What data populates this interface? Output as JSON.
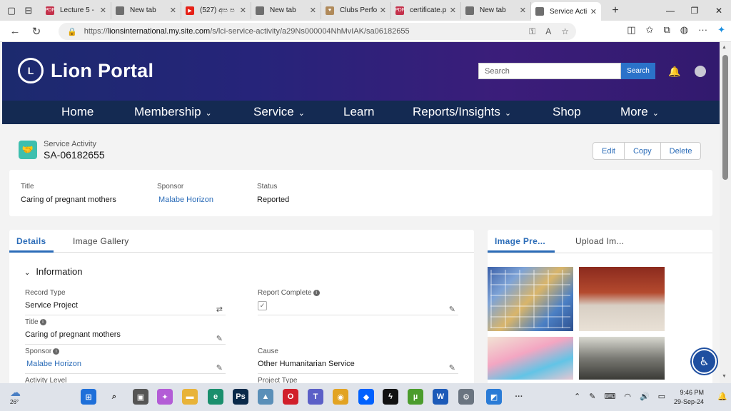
{
  "browser": {
    "tabs": [
      {
        "label": "Lecture 5 -",
        "fav_color": "#c4314b",
        "fav": "PDF"
      },
      {
        "label": "New tab",
        "fav_color": "#6f6f6f",
        "fav": ""
      },
      {
        "label": "(527) අප ප",
        "fav_color": "#e62117",
        "fav": "▶"
      },
      {
        "label": "New tab",
        "fav_color": "#6f6f6f",
        "fav": ""
      },
      {
        "label": "Clubs Perfo",
        "fav_color": "#b08a5a",
        "fav": "♥"
      },
      {
        "label": "certificate.p",
        "fav_color": "#c4314b",
        "fav": "PDF"
      },
      {
        "label": "New tab",
        "fav_color": "#6f6f6f",
        "fav": ""
      },
      {
        "label": "Service Acti",
        "fav_color": "#6f6f6f",
        "fav": ""
      }
    ],
    "url_host": "lionsinternational.my.site.com",
    "url_path": "/s/lci-service-activity/a29Ns000004NhMvIAK/sa06182655",
    "url_scheme": "https://"
  },
  "portal": {
    "title": "Lion Portal",
    "seal_text": "L",
    "search_placeholder": "Search",
    "search_button": "Search",
    "menu": [
      {
        "label": "Home",
        "chev": ""
      },
      {
        "label": "Membership",
        "chev": "⌄"
      },
      {
        "label": "Service",
        "chev": "⌄"
      },
      {
        "label": "Learn",
        "chev": ""
      },
      {
        "label": "Reports/Insights",
        "chev": "⌄"
      },
      {
        "label": "Shop",
        "chev": ""
      },
      {
        "label": "More",
        "chev": "⌄"
      }
    ]
  },
  "record": {
    "type_label": "Service Activity",
    "name": "SA-06182655",
    "actions": [
      "Edit",
      "Copy",
      "Delete"
    ],
    "highlights": [
      {
        "label": "Title",
        "value": "Caring of pregnant mothers"
      },
      {
        "label": "Sponsor",
        "value": "Malabe Horizon"
      },
      {
        "label": "Status",
        "value": "Reported"
      }
    ]
  },
  "details": {
    "tabs": [
      "Details",
      "Image Gallery"
    ],
    "section": "Information",
    "fields": [
      {
        "label": "Record Type",
        "value": "Service Project"
      },
      {
        "label": "Report Complete",
        "value": "✓"
      },
      {
        "label": "Title",
        "value": "Caring of pregnant mothers"
      },
      {
        "label": "Sponsor",
        "value": "Malabe Horizon"
      },
      {
        "label": "Cause",
        "value": "Other Humanitarian Service"
      },
      {
        "label": "Activity Level",
        "value": ""
      },
      {
        "label": "Project Type",
        "value": ""
      }
    ]
  },
  "images": {
    "tabs": [
      "Image Pre...",
      "Upload Im..."
    ]
  },
  "taskbar": {
    "temp": "26°",
    "time": "9:46 PM",
    "date": "29-Sep-24",
    "apps": [
      {
        "label": "⊞",
        "color": "#1e6fd9"
      },
      {
        "label": "⌕",
        "color": "#333"
      },
      {
        "label": "▣",
        "color": "#555"
      },
      {
        "label": "✦",
        "color": "#b35cd6"
      },
      {
        "label": "▬",
        "color": "#e8b339"
      },
      {
        "label": "e",
        "color": "#1a8f6d"
      },
      {
        "label": "Ps",
        "color": "#0b2a4a"
      },
      {
        "label": "▲",
        "color": "#5a8fb8"
      },
      {
        "label": "O",
        "color": "#d11f2a"
      },
      {
        "label": "T",
        "color": "#5b5fc7"
      },
      {
        "label": "◉",
        "color": "#e2a322"
      },
      {
        "label": "◆",
        "color": "#0061fe"
      },
      {
        "label": "ϟ",
        "color": "#111"
      },
      {
        "label": "µ",
        "color": "#4b9c2c"
      },
      {
        "label": "W",
        "color": "#1c5ab8"
      },
      {
        "label": "⚙",
        "color": "#6a7480"
      },
      {
        "label": "◩",
        "color": "#2a7bd6"
      },
      {
        "label": "···",
        "color": "#333"
      }
    ]
  }
}
